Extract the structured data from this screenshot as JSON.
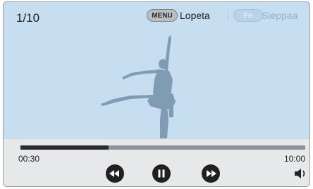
{
  "header": {
    "counter": "1/10",
    "menu_key": "MENU",
    "menu_label": "Lopeta",
    "fn_key": "Fn",
    "fn_label": "Sieppaa"
  },
  "playback": {
    "elapsed": "00:30",
    "total": "10:00",
    "progress_fraction": 0.31,
    "state": "playing"
  },
  "icons": {
    "rewind": "rewind-icon",
    "pause": "pause-icon",
    "forward": "fast-forward-icon",
    "volume": "speaker-icon"
  },
  "colors": {
    "scene_background": "#c6def0",
    "silhouette": "#7f9cb4",
    "controls_background": "#e6e8ea",
    "progress_fill": "#2a2a2a",
    "progress_track": "#8e9399"
  }
}
